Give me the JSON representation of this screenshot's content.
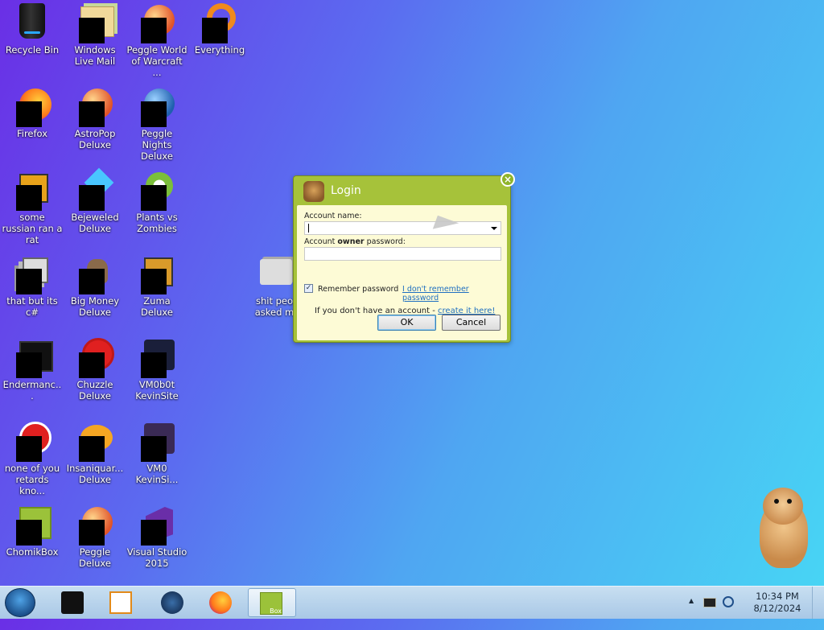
{
  "desktop_icons": [
    {
      "name": "recycle-bin",
      "label": "Recycle Bin"
    },
    {
      "name": "windows-live-mail",
      "label": "Windows Live Mail"
    },
    {
      "name": "peggle-world-of-warcraft",
      "label": "Peggle World of Warcraft ..."
    },
    {
      "name": "everything",
      "label": "Everything"
    },
    {
      "name": "firefox",
      "label": "Firefox"
    },
    {
      "name": "astropop-deluxe",
      "label": "AstroPop Deluxe"
    },
    {
      "name": "peggle-nights-deluxe",
      "label": "Peggle Nights Deluxe"
    },
    {
      "name": "some-russian-ran-a-rat",
      "label": "some russian ran a rat"
    },
    {
      "name": "bejeweled-deluxe",
      "label": "Bejeweled Deluxe"
    },
    {
      "name": "plants-vs-zombies",
      "label": "Plants vs Zombies"
    },
    {
      "name": "that-but-its-csharp",
      "label": "that but its c#"
    },
    {
      "name": "big-money-deluxe",
      "label": "Big Money Deluxe"
    },
    {
      "name": "zuma-deluxe",
      "label": "Zuma Deluxe"
    },
    {
      "name": "shit-peo-asked-m",
      "label": "shit peo asked m"
    },
    {
      "name": "endermanc",
      "label": "Endermanc..."
    },
    {
      "name": "chuzzle-deluxe",
      "label": "Chuzzle Deluxe"
    },
    {
      "name": "vm0b0t-kevinsite",
      "label": "VM0b0t KevinSite"
    },
    {
      "name": "none-of-you",
      "label": "none of you retards kno..."
    },
    {
      "name": "insaniquarium-deluxe",
      "label": "Insaniquar... Deluxe"
    },
    {
      "name": "vm0-kevinsi",
      "label": "VM0 KevinSi..."
    },
    {
      "name": "chomikbox",
      "label": "ChomikBox"
    },
    {
      "name": "peggle-deluxe",
      "label": "Peggle Deluxe"
    },
    {
      "name": "visual-studio-2015",
      "label": "Visual Studio 2015"
    }
  ],
  "login": {
    "title": "Login",
    "close_glyph": "×",
    "account_name_label": "Account name:",
    "account_name_value": "",
    "password_label_pre": "Account ",
    "password_label_bold": "owner",
    "password_label_post": " password:",
    "password_value": "",
    "remember_label": "Remember password",
    "remember_checked": true,
    "checkbox_glyph": "✓",
    "forgot_link": "I don't remember password",
    "no_account_text": "If you don't have an account - ",
    "create_link": "create it here!",
    "ok_label": "OK",
    "cancel_label": "Cancel"
  },
  "taskbar": {
    "items": [
      "terminal",
      "media-player",
      "browser-globe",
      "firefox",
      "chomikbox"
    ],
    "active": "chomikbox",
    "box_label": "Box",
    "time": "10:34 PM",
    "date": "8/12/2024",
    "tray_arrow": "▲"
  }
}
